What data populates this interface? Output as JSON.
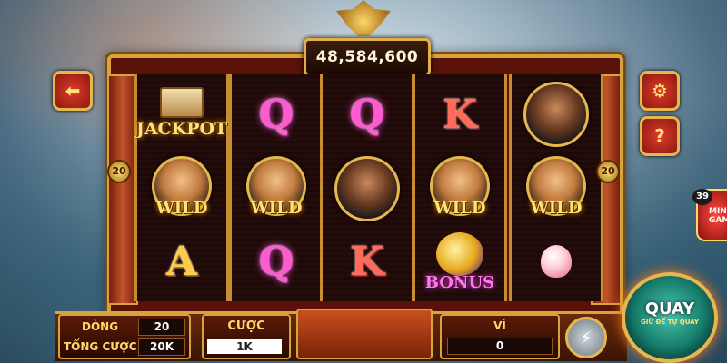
{
  "jackpot": {
    "value": "48,584,600"
  },
  "line_markers": {
    "left": "20",
    "right": "20"
  },
  "reels": [
    [
      {
        "kind": "jackpot",
        "label": "JACKPOT"
      },
      {
        "kind": "wild",
        "label": "WILD",
        "portrait": "monk"
      },
      {
        "kind": "letter",
        "label": "A",
        "style": "a"
      }
    ],
    [
      {
        "kind": "letter",
        "label": "Q",
        "style": "q"
      },
      {
        "kind": "wild",
        "label": "WILD",
        "portrait": "monk"
      },
      {
        "kind": "letter",
        "label": "Q",
        "style": "q"
      }
    ],
    [
      {
        "kind": "letter",
        "label": "Q",
        "style": "q"
      },
      {
        "kind": "portrait",
        "portrait": "warrior"
      },
      {
        "kind": "letter",
        "label": "K",
        "style": "k"
      }
    ],
    [
      {
        "kind": "letter",
        "label": "K",
        "style": "k"
      },
      {
        "kind": "wild",
        "label": "WILD",
        "portrait": "monk"
      },
      {
        "kind": "bonus",
        "label": "BONUS"
      }
    ],
    [
      {
        "kind": "portrait",
        "portrait": "warrior"
      },
      {
        "kind": "wild",
        "label": "WILD",
        "portrait": "monk"
      },
      {
        "kind": "peach"
      }
    ]
  ],
  "side_buttons": {
    "back_icon": "back-arrow-icon",
    "settings_icon": "gear-icon",
    "help_icon": "question-icon"
  },
  "bottom": {
    "dong_label": "DÒNG",
    "dong_value": "20",
    "tong_cuoc_label": "TỔNG CƯỢC",
    "tong_cuoc_value": "20K",
    "cuoc_label": "CƯỢC",
    "cuoc_value": "1K",
    "vi_label": "VÍ",
    "vi_value": "0"
  },
  "spin": {
    "label": "QUAY",
    "sub": "GIỮ ĐỂ TỰ QUAY"
  },
  "mini_game": {
    "count": "39",
    "label": "MINI GAME"
  },
  "colors": {
    "frame_gold": "#d7a33b",
    "reel_bg": "#1d0a08",
    "spin_teal": "#157a6a"
  }
}
